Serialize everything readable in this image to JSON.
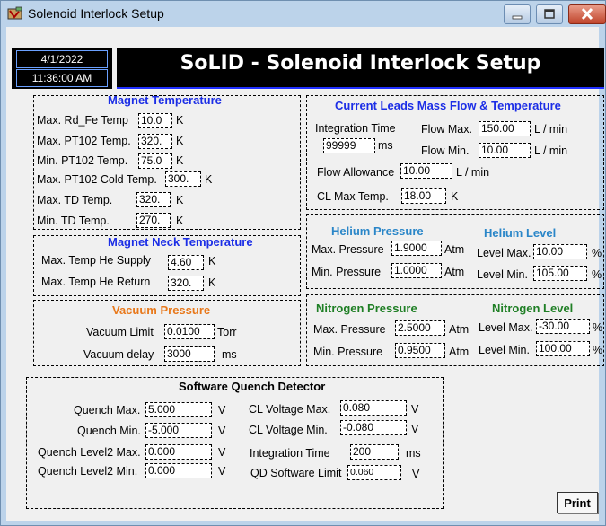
{
  "window": {
    "title": "Solenoid Interlock Setup"
  },
  "header": {
    "date": "4/1/2022",
    "time": "11:36:00 AM",
    "banner": "SoLID - Solenoid Interlock Setup"
  },
  "magnet_temperature": {
    "title": "Magnet Temperature",
    "rows": [
      {
        "label": "Max. Rd_Fe Temp",
        "value": "10.0",
        "unit": "K"
      },
      {
        "label": "Max. PT102 Temp.",
        "value": "320.",
        "unit": "K"
      },
      {
        "label": "Min. PT102 Temp.",
        "value": "75.0",
        "unit": "K"
      },
      {
        "label": "Max. PT102 Cold Temp.",
        "value": "300.",
        "unit": "K"
      },
      {
        "label": "Max. TD Temp.",
        "value": "320.",
        "unit": "K"
      },
      {
        "label": "Min. TD Temp.",
        "value": "270.",
        "unit": "K"
      }
    ]
  },
  "magnet_neck": {
    "title": "Magnet Neck Temperature",
    "rows": [
      {
        "label": "Max. Temp He Supply",
        "value": "4.60",
        "unit": "K"
      },
      {
        "label": "Max. Temp He Return",
        "value": "320.",
        "unit": "K"
      }
    ]
  },
  "vacuum": {
    "title": "Vacuum Pressure",
    "rows": [
      {
        "label": "Vacuum Limit",
        "value": "0.0100",
        "unit": "Torr"
      },
      {
        "label": "Vacuum delay",
        "value": "3000",
        "unit": "ms"
      }
    ]
  },
  "current_leads": {
    "title": "Current Leads Mass Flow & Temperature",
    "integration_label": "Integration Time",
    "integration_value": "99999",
    "integration_unit": "ms",
    "flow_max_label": "Flow Max.",
    "flow_max_value": "150.00",
    "flow_max_unit": "L / min",
    "flow_min_label": "Flow Min.",
    "flow_min_value": "10.00",
    "flow_min_unit": "L / min",
    "allowance_label": "Flow Allowance",
    "allowance_value": "10.00",
    "allowance_unit": "L / min",
    "cl_max_label": "CL Max Temp.",
    "cl_max_value": "18.00",
    "cl_max_unit": "K"
  },
  "helium": {
    "pressure_title": "Helium Pressure",
    "level_title": "Helium Level",
    "max_p_label": "Max. Pressure",
    "max_p_value": "1.9000",
    "p_unit": "Atm",
    "min_p_label": "Min. Pressure",
    "min_p_value": "1.0000",
    "lvl_max_label": "Level Max.",
    "lvl_max_value": "10.00",
    "lvl_unit": "%",
    "lvl_min_label": "Level Min.",
    "lvl_min_value": "105.00"
  },
  "nitrogen": {
    "pressure_title": "Nitrogen Pressure",
    "level_title": "Nitrogen Level",
    "max_p_label": "Max. Pressure",
    "max_p_value": "2.5000",
    "p_unit": "Atm",
    "min_p_label": "Min. Pressure",
    "min_p_value": "0.9500",
    "lvl_max_label": "Level Max.",
    "lvl_max_value": "-30.00",
    "lvl_unit": "%",
    "lvl_min_label": "Level Min.",
    "lvl_min_value": "100.00"
  },
  "quench": {
    "title": "Software Quench Detector",
    "left": [
      {
        "label": "Quench Max.",
        "value": "5.000",
        "unit": "V"
      },
      {
        "label": "Quench Min.",
        "value": "-5.000",
        "unit": "V"
      },
      {
        "label": "Quench Level2 Max.",
        "value": "0.000",
        "unit": "V"
      },
      {
        "label": "Quench Level2 Min.",
        "value": "0.000",
        "unit": "V"
      }
    ],
    "right": [
      {
        "label": "CL Voltage Max.",
        "value": "0.080",
        "unit": "V"
      },
      {
        "label": "CL Voltage Min.",
        "value": "-0.080",
        "unit": "V"
      },
      {
        "label": "Integration Time",
        "value": "200",
        "unit": "ms"
      },
      {
        "label": "QD Software Limit",
        "value": "0.060",
        "unit": "V"
      }
    ]
  },
  "buttons": {
    "print": "Print"
  },
  "colors": {
    "accent_blue": "#1c2ee6",
    "light_blue": "#2a86c8",
    "green": "#1f7f25",
    "orange": "#e8781a",
    "banner_bg": "#000000"
  },
  "icons": {
    "app": "solenoid-app-icon",
    "minimize": "minimize-icon",
    "maximize": "maximize-icon",
    "close": "close-icon"
  }
}
